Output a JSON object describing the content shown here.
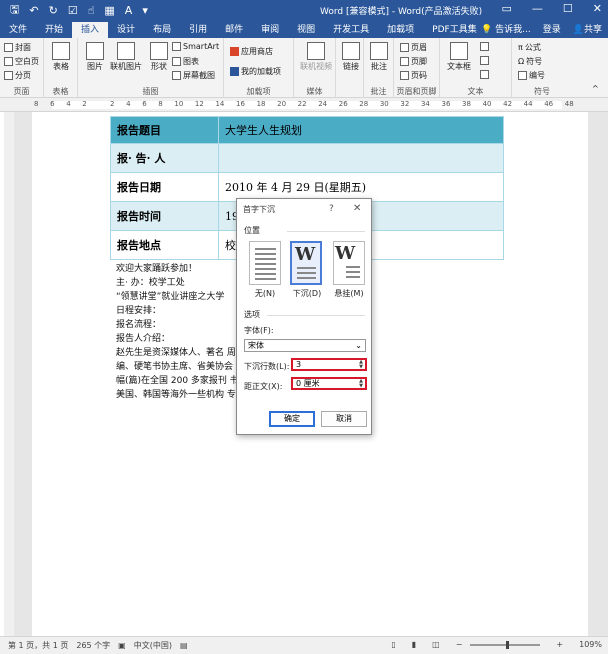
{
  "titlebar": {
    "title": "Word [兼容模式] - Word(产品激活失败)",
    "qat_icons": [
      "save-icon",
      "undo-icon",
      "redo-icon",
      "checkbox-icon",
      "touch-icon",
      "format-icon",
      "font-color-icon",
      "customize-icon"
    ]
  },
  "tabs": [
    "文件",
    "开始",
    "插入",
    "设计",
    "布局",
    "引用",
    "邮件",
    "审阅",
    "视图",
    "开发工具",
    "加载项",
    "PDF工具集"
  ],
  "active_tab": "插入",
  "tellme": "告诉我...",
  "login": "登录",
  "share": "共享",
  "ribbon": {
    "pages": {
      "cover": "封面",
      "blank": "空白页",
      "break": "分页",
      "label": "页面"
    },
    "tables": {
      "table": "表格",
      "label": "表格"
    },
    "illustrations": {
      "picture": "图片",
      "online_picture": "联机图片",
      "shapes": "形状",
      "smartart": "SmartArt",
      "chart": "图表",
      "screenshot": "屏幕截图",
      "label": "插图"
    },
    "addins": {
      "store": "应用商店",
      "my_addins": "我的加载项",
      "label": "加载项"
    },
    "media": {
      "online_video": "联机视频",
      "label": "媒体"
    },
    "links": {
      "link": "链接",
      "label": ""
    },
    "comments": {
      "comment": "批注",
      "label": "批注"
    },
    "header_footer": {
      "header": "页眉",
      "footer": "页脚",
      "page_number": "页码",
      "label": "页眉和页脚"
    },
    "text": {
      "textbox": "文本框",
      "label": "文本"
    },
    "symbols": {
      "equation": "公式",
      "symbol": "符号",
      "number": "编号",
      "label": "符号"
    }
  },
  "ruler_numbers": [
    "8",
    "6",
    "4",
    "2",
    "",
    "2",
    "4",
    "6",
    "8",
    "10",
    "12",
    "14",
    "16",
    "18",
    "20",
    "22",
    "24",
    "26",
    "28",
    "30",
    "32",
    "34",
    "36",
    "38",
    "40",
    "42",
    "44",
    "46",
    "48"
  ],
  "table": {
    "rows": [
      {
        "label": "报告题目",
        "value": "大学生人生规划",
        "style": "hdr"
      },
      {
        "label": "报· 告· 人",
        "value": "",
        "style": "alt"
      },
      {
        "label": "报告日期",
        "value": "2010 年 4 月 29 日(星期五)",
        "style": ""
      },
      {
        "label": "报告时间",
        "value": "19",
        "style": "alt"
      },
      {
        "label": "报告地点",
        "value": "校",
        "style": ""
      }
    ]
  },
  "body_lines": [
    "欢迎大家踊跃参加！",
    "主· 办：校学工处",
    "“领慧讲堂”就业讲座之大学",
    "日程安排：",
    "报名流程：",
    "报告人介绍：",
    "赵先生是资深媒体人、著名                                    周刊主编。现任某出版集团总",
    "编、硬笔书协主席、省美协会                                    、美术、文章、摄影作品千余",
    "幅(篇)在全国 200 多家报刊                                    书画家辞典。书画作品被日本、",
    "美国、韩国等海外一些机构                                    专题摄影展和书画展。"
  ],
  "dialog": {
    "title": "首字下沉",
    "help": "?",
    "close": "✕",
    "position_label": "位置",
    "opt_none": "无(N)",
    "opt_drop": "下沉(D)",
    "opt_margin": "悬挂(M)",
    "options_label": "选项",
    "font_label": "字体(F):",
    "font_value": "宋体",
    "lines_label": "下沉行数(L):",
    "lines_value": "3",
    "distance_label": "距正文(X):",
    "distance_value": "0 厘米",
    "ok": "确定",
    "cancel": "取消"
  },
  "status": {
    "page": "第 1 页，共 1 页",
    "words": "265 个字",
    "lang": "中文(中国)",
    "zoom": "109%"
  },
  "colors": {
    "brand": "#2b579a",
    "table_header": "#4bacc6",
    "table_alt": "#daeef3",
    "highlight": "#d6182a"
  }
}
